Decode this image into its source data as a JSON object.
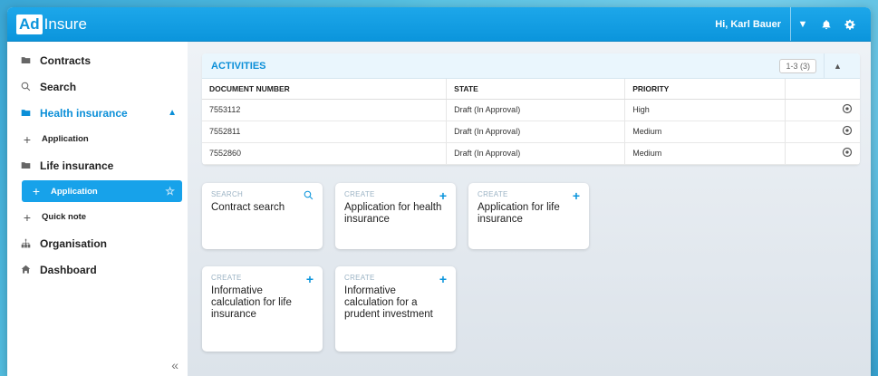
{
  "header": {
    "logo_ad": "Ad",
    "logo_rest": "Insure",
    "greeting": "Hi, Karl Bauer"
  },
  "sidebar": {
    "items": [
      {
        "label": "Contracts",
        "icon": "folder-icon"
      },
      {
        "label": "Search",
        "icon": "search-icon"
      },
      {
        "label": "Health insurance",
        "icon": "folder-edit-icon"
      },
      {
        "label": "Application",
        "icon": "plus-icon"
      },
      {
        "label": "Life insurance",
        "icon": "folder-edit-icon"
      },
      {
        "label": "Application",
        "icon": "plus-icon"
      },
      {
        "label": "Quick note",
        "icon": "plus-icon"
      },
      {
        "label": "Organisation",
        "icon": "org-chart-icon"
      },
      {
        "label": "Dashboard",
        "icon": "dashboard-icon"
      }
    ]
  },
  "activities": {
    "title": "ACTIVITIES",
    "pager": "1-3 (3)",
    "columns": [
      "DOCUMENT NUMBER",
      "STATE",
      "PRIORITY"
    ],
    "rows": [
      {
        "doc": "7553112",
        "state": "Draft (In Approval)",
        "priority": "High"
      },
      {
        "doc": "7552811",
        "state": "Draft (In Approval)",
        "priority": "Medium"
      },
      {
        "doc": "7552860",
        "state": "Draft (In Approval)",
        "priority": "Medium"
      }
    ]
  },
  "cards": [
    {
      "kind": "SEARCH",
      "title": "Contract search",
      "icon": "search-icon"
    },
    {
      "kind": "CREATE",
      "title": "Application for health insurance",
      "icon": "plus-icon"
    },
    {
      "kind": "CREATE",
      "title": "Application for life insurance",
      "icon": "plus-icon"
    },
    {
      "kind": "CREATE",
      "title": "Informative calculation for life insurance",
      "icon": "plus-icon"
    },
    {
      "kind": "CREATE",
      "title": "Informative calculation for a prudent investment",
      "icon": "plus-icon"
    }
  ],
  "colors": {
    "accent": "#0b95dc",
    "active_item": "#17a2ea"
  }
}
